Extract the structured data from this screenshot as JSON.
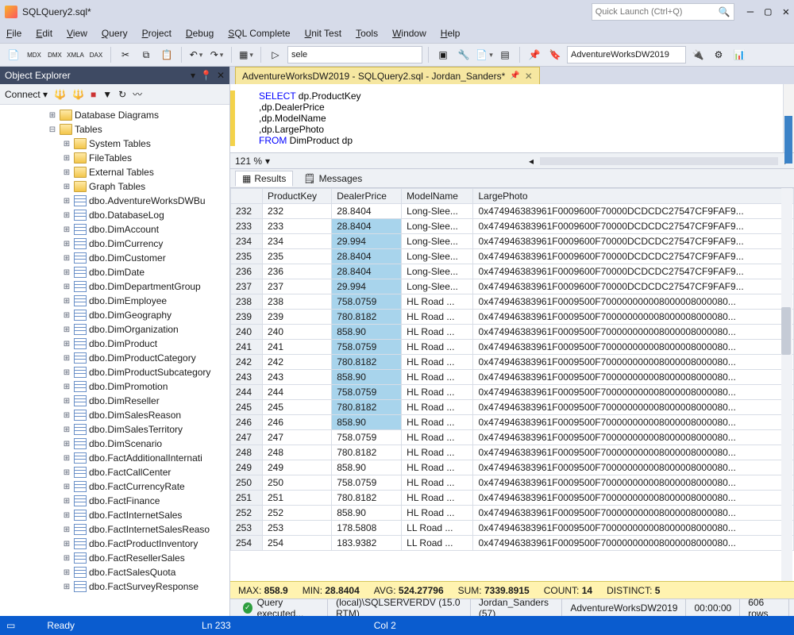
{
  "window": {
    "title": "SQLQuery2.sql*"
  },
  "quick_launch": {
    "placeholder": "Quick Launch (Ctrl+Q)"
  },
  "menu": [
    "File",
    "Edit",
    "View",
    "Query",
    "Project",
    "Debug",
    "SQL Complete",
    "Unit Test",
    "Tools",
    "Window",
    "Help"
  ],
  "toolbar": {
    "sele_text": "sele",
    "db_dropdown": "AdventureWorksDW2019"
  },
  "object_explorer": {
    "title": "Object Explorer",
    "connect_label": "Connect",
    "folders": [
      {
        "label": "Database Diagrams",
        "icon": "folder",
        "indent": 60
      },
      {
        "label": "Tables",
        "icon": "folder",
        "indent": 60,
        "expanded": true
      },
      {
        "label": "System Tables",
        "icon": "folder",
        "indent": 78
      },
      {
        "label": "FileTables",
        "icon": "folder",
        "indent": 78
      },
      {
        "label": "External Tables",
        "icon": "folder",
        "indent": 78
      },
      {
        "label": "Graph Tables",
        "icon": "folder",
        "indent": 78
      }
    ],
    "tables": [
      "dbo.AdventureWorksDWBu",
      "dbo.DatabaseLog",
      "dbo.DimAccount",
      "dbo.DimCurrency",
      "dbo.DimCustomer",
      "dbo.DimDate",
      "dbo.DimDepartmentGroup",
      "dbo.DimEmployee",
      "dbo.DimGeography",
      "dbo.DimOrganization",
      "dbo.DimProduct",
      "dbo.DimProductCategory",
      "dbo.DimProductSubcategory",
      "dbo.DimPromotion",
      "dbo.DimReseller",
      "dbo.DimSalesReason",
      "dbo.DimSalesTerritory",
      "dbo.DimScenario",
      "dbo.FactAdditionalInternati",
      "dbo.FactCallCenter",
      "dbo.FactCurrencyRate",
      "dbo.FactFinance",
      "dbo.FactInternetSales",
      "dbo.FactInternetSalesReaso",
      "dbo.FactProductInventory",
      "dbo.FactResellerSales",
      "dbo.FactSalesQuota",
      "dbo.FactSurveyResponse"
    ]
  },
  "document": {
    "tab_label": "AdventureWorksDW2019 - SQLQuery2.sql - Jordan_Sanders*",
    "code_lines": [
      {
        "kw": "SELECT",
        "rest": " dp.ProductKey"
      },
      {
        "kw": "",
        "rest": "      ,dp.DealerPrice"
      },
      {
        "kw": "",
        "rest": "      ,dp.ModelName"
      },
      {
        "kw": "",
        "rest": "      ,dp.LargePhoto"
      },
      {
        "kw": "FROM",
        "rest": " DimProduct dp"
      }
    ],
    "zoom": "121 %"
  },
  "results": {
    "tab_results": "Results",
    "tab_messages": "Messages",
    "columns": [
      "",
      "ProductKey",
      "DealerPrice",
      "ModelName",
      "LargePhoto"
    ],
    "highlight_start": 1,
    "highlight_end": 14,
    "rows": [
      {
        "n": 232,
        "pk": 232,
        "dp": "28.8404",
        "mn": "Long-Slee...",
        "lp": "0x474946383961F0009600F70000DCDCDC27547CF9FAF9..."
      },
      {
        "n": 233,
        "pk": 233,
        "dp": "28.8404",
        "mn": "Long-Slee...",
        "lp": "0x474946383961F0009600F70000DCDCDC27547CF9FAF9..."
      },
      {
        "n": 234,
        "pk": 234,
        "dp": "29.994",
        "mn": "Long-Slee...",
        "lp": "0x474946383961F0009600F70000DCDCDC27547CF9FAF9..."
      },
      {
        "n": 235,
        "pk": 235,
        "dp": "28.8404",
        "mn": "Long-Slee...",
        "lp": "0x474946383961F0009600F70000DCDCDC27547CF9FAF9..."
      },
      {
        "n": 236,
        "pk": 236,
        "dp": "28.8404",
        "mn": "Long-Slee...",
        "lp": "0x474946383961F0009600F70000DCDCDC27547CF9FAF9..."
      },
      {
        "n": 237,
        "pk": 237,
        "dp": "29.994",
        "mn": "Long-Slee...",
        "lp": "0x474946383961F0009600F70000DCDCDC27547CF9FAF9..."
      },
      {
        "n": 238,
        "pk": 238,
        "dp": "758.0759",
        "mn": "HL Road ...",
        "lp": "0x474946383961F0009500F700000000008000008000080..."
      },
      {
        "n": 239,
        "pk": 239,
        "dp": "780.8182",
        "mn": "HL Road ...",
        "lp": "0x474946383961F0009500F700000000008000008000080..."
      },
      {
        "n": 240,
        "pk": 240,
        "dp": "858.90",
        "mn": "HL Road ...",
        "lp": "0x474946383961F0009500F700000000008000008000080..."
      },
      {
        "n": 241,
        "pk": 241,
        "dp": "758.0759",
        "mn": "HL Road ...",
        "lp": "0x474946383961F0009500F700000000008000008000080..."
      },
      {
        "n": 242,
        "pk": 242,
        "dp": "780.8182",
        "mn": "HL Road ...",
        "lp": "0x474946383961F0009500F700000000008000008000080..."
      },
      {
        "n": 243,
        "pk": 243,
        "dp": "858.90",
        "mn": "HL Road ...",
        "lp": "0x474946383961F0009500F700000000008000008000080..."
      },
      {
        "n": 244,
        "pk": 244,
        "dp": "758.0759",
        "mn": "HL Road ...",
        "lp": "0x474946383961F0009500F700000000008000008000080..."
      },
      {
        "n": 245,
        "pk": 245,
        "dp": "780.8182",
        "mn": "HL Road ...",
        "lp": "0x474946383961F0009500F700000000008000008000080..."
      },
      {
        "n": 246,
        "pk": 246,
        "dp": "858.90",
        "mn": "HL Road ...",
        "lp": "0x474946383961F0009500F700000000008000008000080..."
      },
      {
        "n": 247,
        "pk": 247,
        "dp": "758.0759",
        "mn": "HL Road ...",
        "lp": "0x474946383961F0009500F700000000008000008000080..."
      },
      {
        "n": 248,
        "pk": 248,
        "dp": "780.8182",
        "mn": "HL Road ...",
        "lp": "0x474946383961F0009500F700000000008000008000080..."
      },
      {
        "n": 249,
        "pk": 249,
        "dp": "858.90",
        "mn": "HL Road ...",
        "lp": "0x474946383961F0009500F700000000008000008000080..."
      },
      {
        "n": 250,
        "pk": 250,
        "dp": "758.0759",
        "mn": "HL Road ...",
        "lp": "0x474946383961F0009500F700000000008000008000080..."
      },
      {
        "n": 251,
        "pk": 251,
        "dp": "780.8182",
        "mn": "HL Road ...",
        "lp": "0x474946383961F0009500F700000000008000008000080..."
      },
      {
        "n": 252,
        "pk": 252,
        "dp": "858.90",
        "mn": "HL Road ...",
        "lp": "0x474946383961F0009500F700000000008000008000080..."
      },
      {
        "n": 253,
        "pk": 253,
        "dp": "178.5808",
        "mn": "LL Road ...",
        "lp": "0x474946383961F0009500F700000000008000008000080..."
      },
      {
        "n": 254,
        "pk": 254,
        "dp": "183.9382",
        "mn": "LL Road ...",
        "lp": "0x474946383961F0009500F700000000008000008000080..."
      }
    ],
    "stats": {
      "max": "858.9",
      "min": "28.8404",
      "avg": "524.27796",
      "sum": "7339.8915",
      "count": "14",
      "distinct": "5"
    }
  },
  "exec": {
    "status": "Query  executed...",
    "server": "(local)\\SQLSERVERDV (15.0 RTM)",
    "user": "Jordan_Sanders (57)",
    "db": "AdventureWorksDW2019",
    "time": "00:00:00",
    "rows": "606 rows"
  },
  "status": {
    "ready": "Ready",
    "ln": "Ln 233",
    "col": "Col 2"
  }
}
